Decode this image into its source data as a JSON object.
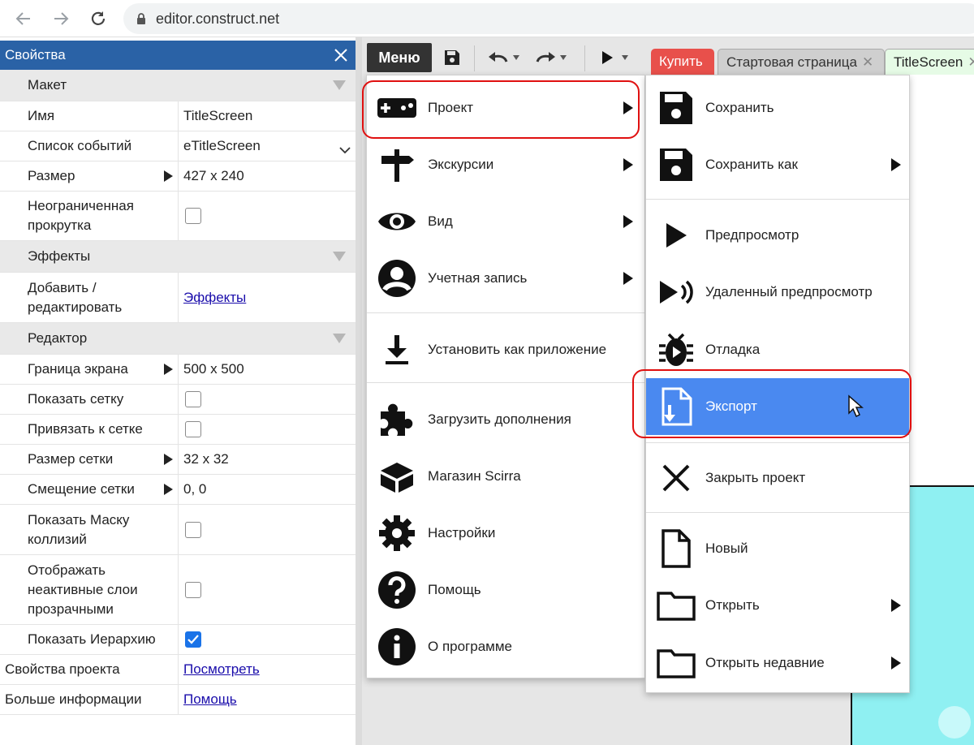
{
  "browser": {
    "back_icon": "arrow-left-icon",
    "forward_icon": "arrow-right-icon",
    "reload_icon": "reload-icon",
    "url": "editor.construct.net"
  },
  "properties": {
    "title": "Свойства",
    "section_layout": "Макет",
    "name_label": "Имя",
    "name_value": "TitleScreen",
    "events_label": "Список событий",
    "events_value": "eTitleScreen",
    "size_label": "Размер",
    "size_value": "427 x 240",
    "unbounded_label": "Неограниченная прокрутка",
    "section_effects": "Эффекты",
    "add_edit_label": "Добавить / редактировать",
    "effects_link": "Эффекты",
    "section_editor": "Редактор",
    "screen_border_label": "Граница экрана",
    "screen_border_value": "500 x 500",
    "show_grid_label": "Показать сетку",
    "snap_grid_label": "Привязать к сетке",
    "grid_size_label": "Размер сетки",
    "grid_size_value": "32 x 32",
    "grid_offset_label": "Смещение сетки",
    "grid_offset_value": "0,  0",
    "show_collision_label": "Показать Маску коллизий",
    "inactive_layers_label": "Отображать неактивные слои прозрачными",
    "show_hierarchy_label": "Показать Иерархию",
    "project_props_label": "Свойства проекта",
    "project_props_link": "Посмотреть",
    "more_info_label": "Больше информации",
    "more_info_link": "Помощь"
  },
  "toolbar": {
    "menu_label": "Меню"
  },
  "tabs": {
    "buy": "Купить",
    "start_page": "Стартовая страница",
    "title_screen": "TitleScreen"
  },
  "main_menu": {
    "project": "Проект",
    "tours": "Экскурсии",
    "view": "Вид",
    "account": "Учетная запись",
    "install": "Установить как приложение",
    "addons": "Загрузить дополнения",
    "store": "Магазин Scirra",
    "settings": "Настройки",
    "help": "Помощь",
    "about": "О программе"
  },
  "sub_menu": {
    "save": "Сохранить",
    "save_as": "Сохранить как",
    "preview": "Предпросмотр",
    "remote_preview": "Удаленный предпросмотр",
    "debug": "Отладка",
    "export": "Экспорт",
    "close_project": "Закрыть проект",
    "new": "Новый",
    "open": "Открыть",
    "open_recent": "Открыть недавние"
  },
  "colors": {
    "panel_header": "#2a62a6",
    "menu_button": "#333333",
    "buy_tab": "#e8504b",
    "active_item": "#4a89f0",
    "highlight_ring": "#e01010",
    "canvas": "#8ff0f2"
  }
}
